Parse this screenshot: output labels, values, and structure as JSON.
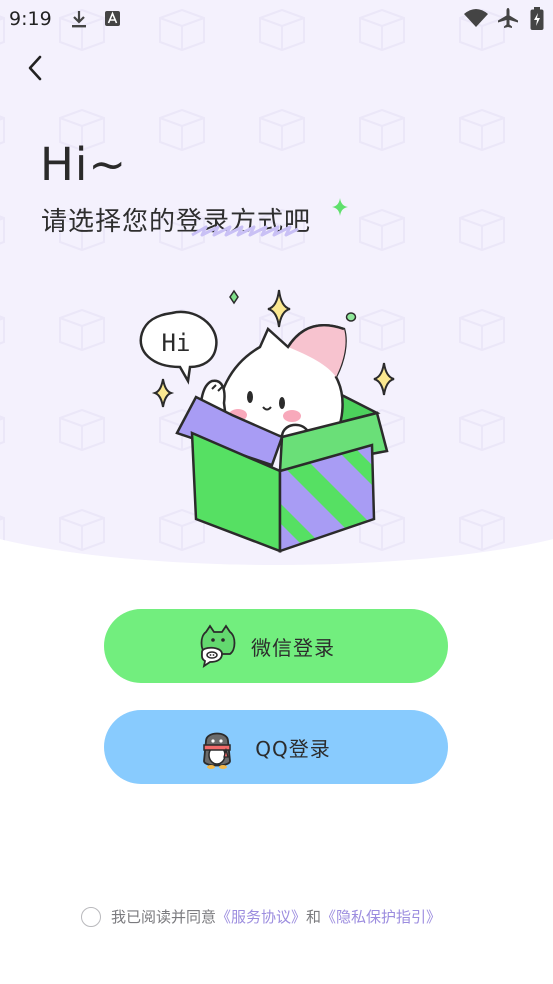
{
  "status_bar": {
    "time": "9:19",
    "icons": [
      "download-icon",
      "a-icon",
      "wifi-icon",
      "airplane-icon",
      "battery-charging-icon"
    ]
  },
  "header": {
    "back_icon": "chevron-left-icon",
    "greeting": "Hi~",
    "subtitle_prefix": "请选择您的",
    "subtitle_highlight": "登录方式",
    "subtitle_suffix": "吧"
  },
  "illustration": {
    "speech_bubble_text": "Hi",
    "colors": {
      "box_green": "#5be36b",
      "box_purple": "#a89cf4",
      "ears_pink": "#f6b9c6",
      "sparkle_yellow": "#fbe890"
    }
  },
  "buttons": {
    "wechat": {
      "label": "微信登录",
      "icon": "wechat-mascot-icon",
      "color": "#72ee7e"
    },
    "qq": {
      "label": "QQ登录",
      "icon": "qq-penguin-icon",
      "color": "#88cbfe"
    }
  },
  "agreement": {
    "prefix": "我已阅读并同意",
    "service_link": "《服务协议》",
    "conjunction": "和",
    "privacy_link": "《隐私保护指引》",
    "accent_color": "#9c8ddf"
  }
}
